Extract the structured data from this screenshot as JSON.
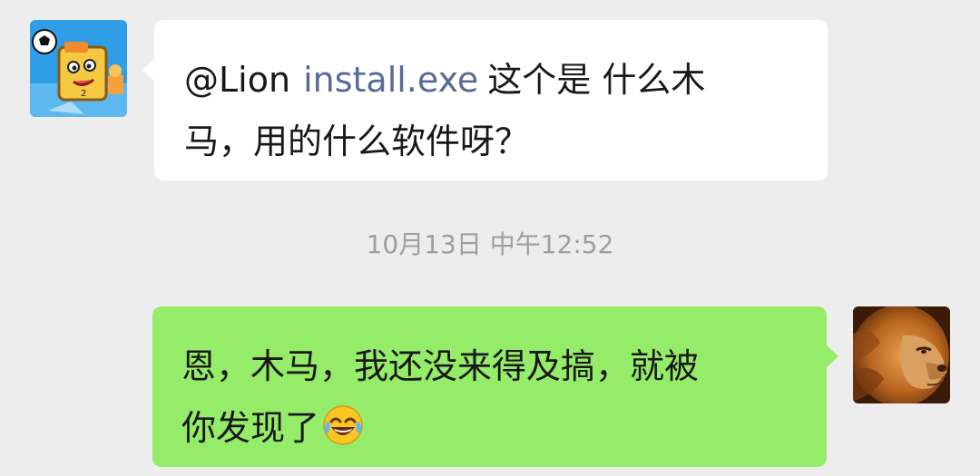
{
  "messages": [
    {
      "sender": "other",
      "avatar_icon": "cartoon-mascot-avatar-icon",
      "mention": "@Lion",
      "link_text": "install.exe",
      "text_line1": "这个是 什么木",
      "text_line2": "马，用的什么软件呀？"
    },
    {
      "sender": "self",
      "avatar_icon": "lion-avatar-icon",
      "text_line1": "恩，木马，我还没来得及搞，就被",
      "text_line2": "你发现了",
      "emoji": "tears-of-joy-emoji-icon"
    }
  ],
  "timestamp": "10月13日 中午12:52",
  "colors": {
    "background": "#ededed",
    "incoming_bubble": "#ffffff",
    "outgoing_bubble": "#95ec69",
    "link": "#576b95",
    "timestamp": "#9e9e9e"
  }
}
